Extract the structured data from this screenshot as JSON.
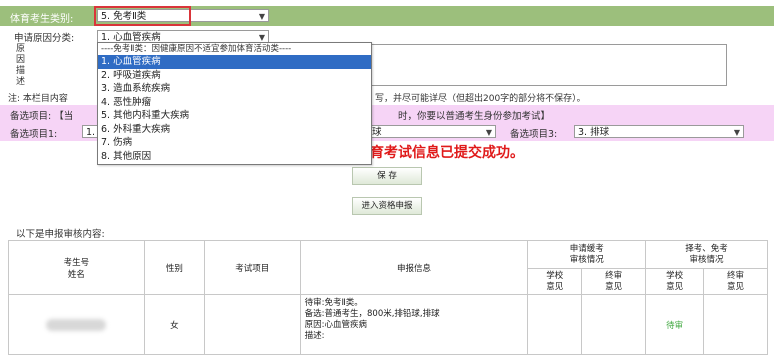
{
  "header": {
    "category_label": "体育考生类别:",
    "category_value": "5. 免考Ⅱ类"
  },
  "reason_row": {
    "label": "申请原因分类:",
    "value": "1. 心血管疾病"
  },
  "desc_label": "原\n因\n描\n述",
  "note": {
    "left": "注: 本栏目内容",
    "right": "写，并尽可能详尽（但超出200字的部分将不保存）。"
  },
  "dropdown": {
    "header": "----免考Ⅱ类：因健康原因不适宜参加体育活动类----",
    "items": [
      "1. 心血管疾病",
      "2. 呼吸道疾病",
      "3. 造血系统疾病",
      "4. 恶性肿瘤",
      "5. 其他内科重大疾病",
      "6. 外科重大疾病",
      "7. 伤病",
      "8. 其他原因"
    ],
    "selected_index": 0
  },
  "optional": {
    "title_left": "备选项目: 【当",
    "title_right": "时，你要以普通考生身份参加考试】",
    "item1_label": "备选项目1:",
    "item1_value": "1.",
    "item2_value": "球",
    "item3_label": "备选项目3:",
    "item3_value": "3. 排球"
  },
  "success_message": "育考试信息已提交成功。",
  "buttons": {
    "save": "保 存",
    "enter_apply": "进入资格申报"
  },
  "table": {
    "caption": "以下是申报审核内容:",
    "headers": {
      "student_no": "考生号",
      "name": "姓名",
      "gender": "性别",
      "subject": "考试项目",
      "info": "申报信息",
      "defer_group": "申请缓考\n审核情况",
      "exempt_group": "择考、免考\n审核情况",
      "school_opinion": "学校\n意见",
      "final_opinion": "终审\n意见"
    },
    "row": {
      "gender": "女",
      "info": "待审:免考Ⅱ类。\n备选:普通考生，800米,排铅球,排球\n原因:心血管疾病\n描述:",
      "status": "待审"
    }
  },
  "colors": {
    "green_bar": "#9cbf7c",
    "pink_bar": "#f6d4f6",
    "highlight": "#d9353a",
    "selected_blue": "#2f6cc4",
    "success_red": "#e01a1a",
    "status_green": "#3fa83f"
  }
}
